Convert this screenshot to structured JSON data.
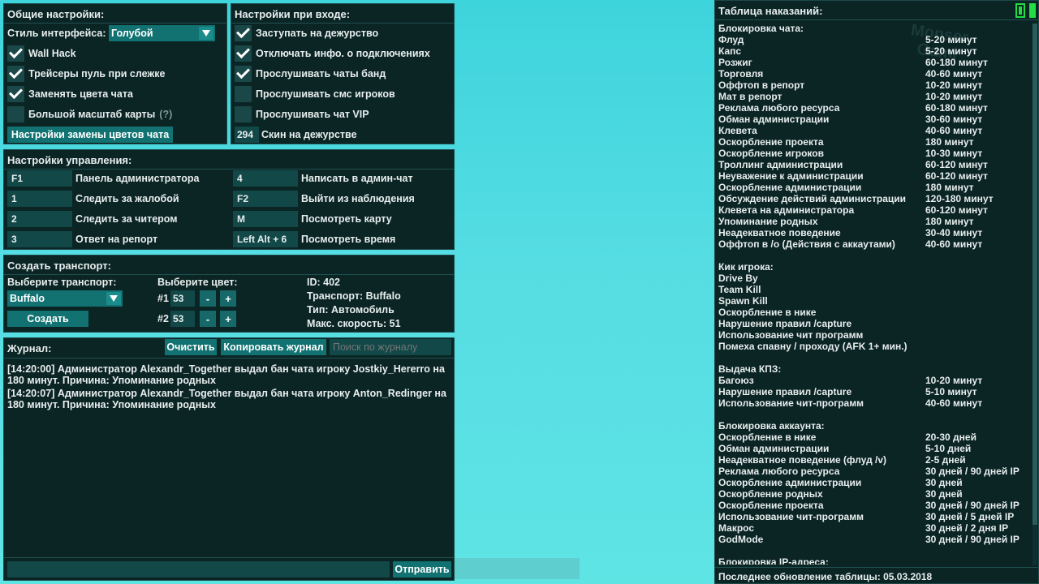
{
  "general": {
    "title": "Общие настройки:",
    "style_label": "Стиль интерфейса:",
    "style_value": "Голубой",
    "options": [
      {
        "label": "Wall Hack",
        "checked": true
      },
      {
        "label": "Трейсеры пуль при слежке",
        "checked": true
      },
      {
        "label": "Заменять цвета чата",
        "checked": true
      },
      {
        "label": "Большой масштаб карты",
        "checked": false,
        "hint": "(?)"
      }
    ],
    "color_button": "Настройки замены цветов чата"
  },
  "login": {
    "title": "Настройки при входе:",
    "options": [
      {
        "label": "Заступать на дежурство",
        "checked": true
      },
      {
        "label": "Отключать инфо. о подключениях",
        "checked": true
      },
      {
        "label": "Прослушивать чаты банд",
        "checked": true
      },
      {
        "label": "Прослушивать смс игроков",
        "checked": false
      },
      {
        "label": "Прослушивать чат VIP",
        "checked": false
      }
    ],
    "skin_value": "294",
    "skin_label": "Скин на дежурстве"
  },
  "controls": {
    "title": "Настройки управления:",
    "left": [
      {
        "key": "F1",
        "label": "Панель администратора"
      },
      {
        "key": "1",
        "label": "Следить за жалобой"
      },
      {
        "key": "2",
        "label": "Следить за читером"
      },
      {
        "key": "3",
        "label": "Ответ на репорт"
      }
    ],
    "right": [
      {
        "key": "4",
        "label": "Написать в админ-чат"
      },
      {
        "key": "F2",
        "label": "Выйти из наблюдения"
      },
      {
        "key": "M",
        "label": "Посмотреть карту"
      },
      {
        "key": "Left Alt + 6",
        "label": "Посмотреть время"
      }
    ]
  },
  "vehicle": {
    "title": "Создать транспорт:",
    "choose_label": "Выберите транспорт:",
    "choose_value": "Buffalo",
    "create_button": "Создать",
    "color_label": "Выберите цвет:",
    "color1_label": "#1",
    "color1_value": "53",
    "color2_label": "#2",
    "color2_value": "53",
    "minus": "-",
    "plus": "+",
    "info": [
      "ID: 402",
      "Транспорт: Buffalo",
      "Тип: Автомобиль",
      "Макс. скорость: 51"
    ]
  },
  "journal": {
    "title": "Журнал:",
    "clear_button": "Очистить",
    "copy_button": "Копировать журнал",
    "search_placeholder": "Поиск по журналу",
    "lines": [
      "[14:20:00] Администратор Alexandr_Together выдал бан чата игроку Jostkiy_Hererro на 180 минут. Причина: Упоминание родных",
      "[14:20:07] Администратор Alexandr_Together выдал бан чата игроку Anton_Redinger на 180 минут. Причина: Упоминание родных"
    ],
    "send_button": "Отправить"
  },
  "punishments": {
    "title": "Таблица наказаний:",
    "watermark": "Monser Gami",
    "sections": [
      {
        "heading": "Блокировка чата:",
        "rows": [
          [
            "Флуд",
            "5-20 минут"
          ],
          [
            "Капс",
            "5-20 минут"
          ],
          [
            "Розжиг",
            "60-180 минут"
          ],
          [
            "Торговля",
            "40-60 минут"
          ],
          [
            "Оффтоп в репорт",
            "10-20 минут"
          ],
          [
            "Мат в репорт",
            "10-20 минут"
          ],
          [
            "Реклама любого ресурса",
            "60-180 минут"
          ],
          [
            "Обман администрации",
            "30-60 минут"
          ],
          [
            "Клевета",
            "40-60 минут"
          ],
          [
            "Оскорбление проекта",
            "180 минут"
          ],
          [
            "Оскорбление игроков",
            "10-30 минут"
          ],
          [
            "Троллинг администрации",
            "60-120 минут"
          ],
          [
            "Неуважение к администрации",
            "60-120 минут"
          ],
          [
            "Оскорбление администрации",
            "180 минут"
          ],
          [
            "Обсуждение действий администрации",
            "120-180 минут"
          ],
          [
            "Клевета на администратора",
            "60-120 минут"
          ],
          [
            "Упоминание родных",
            "180 минут"
          ],
          [
            "Неадекватное поведение",
            "30-40 минут"
          ],
          [
            "Оффтоп в /o (Действия с аккаутами)",
            "40-60 минут"
          ]
        ]
      },
      {
        "heading": "Кик игрока:",
        "rows": [
          [
            "Drive By",
            ""
          ],
          [
            "Team Kill",
            ""
          ],
          [
            "Spawn Kill",
            ""
          ],
          [
            "Оскорбление в нике",
            ""
          ],
          [
            "Нарушение правил /capture",
            ""
          ],
          [
            "Использование чит программ",
            ""
          ],
          [
            "Помеха спавну / проходу (AFK 1+ мин.)",
            ""
          ]
        ]
      },
      {
        "heading": "Выдача КПЗ:",
        "rows": [
          [
            "Багоюз",
            "10-20 минут"
          ],
          [
            "Нарушение правил /capture",
            "5-10 минут"
          ],
          [
            "Использование чит-программ",
            "40-60 минут"
          ]
        ]
      },
      {
        "heading": "Блокировка аккаунта:",
        "rows": [
          [
            "Оскорбление в нике",
            "20-30 дней"
          ],
          [
            "Обман администрации",
            "5-10 дней"
          ],
          [
            "Неадекватное поведение (флуд /v)",
            "2-5 дней"
          ],
          [
            "Реклама любого ресурса",
            "30 дней / 90 дней IP"
          ],
          [
            "Оскорбление администрации",
            "30 дней"
          ],
          [
            "Оскорбление родных",
            "30 дней"
          ],
          [
            "Оскорбление проекта",
            "30 дней / 90 дней IP"
          ],
          [
            "Использование чит-программ",
            "30 дней / 5 дней IP"
          ],
          [
            "Макрос",
            "30 дней / 2 дня IP"
          ],
          [
            "GodMode",
            "30 дней / 90 дней IP"
          ]
        ]
      },
      {
        "heading": "Блокировка IP-адреса:",
        "rows": []
      }
    ],
    "footer": "Последнее обновление таблицы: 05.03.2018"
  },
  "colors": {
    "panel_bg": "#0b2424",
    "accent": "#127272",
    "field": "#124848",
    "indicator": "#22dd44"
  }
}
